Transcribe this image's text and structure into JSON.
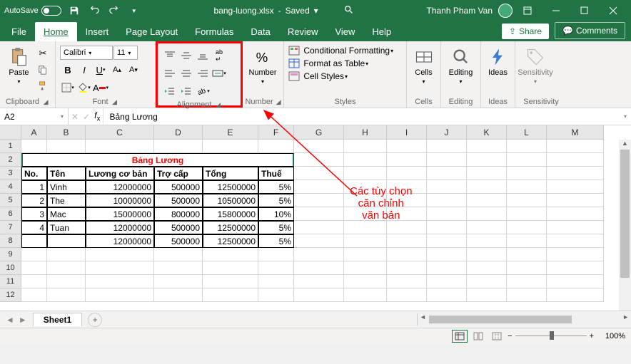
{
  "titlebar": {
    "autosave": "AutoSave",
    "filename": "bang-luong.xlsx",
    "status": "Saved",
    "username": "Thanh Pham Van"
  },
  "tabs": {
    "file": "File",
    "home": "Home",
    "insert": "Insert",
    "pagelayout": "Page Layout",
    "formulas": "Formulas",
    "data": "Data",
    "review": "Review",
    "view": "View",
    "help": "Help",
    "share": "Share",
    "comments": "Comments"
  },
  "ribbon": {
    "clipboard": {
      "label": "Clipboard",
      "paste": "Paste"
    },
    "font": {
      "label": "Font",
      "name": "Calibri",
      "size": "11"
    },
    "alignment": {
      "label": "Alignment"
    },
    "number": {
      "label": "Number",
      "btn": "Number"
    },
    "styles": {
      "label": "Styles",
      "cond": "Conditional Formatting",
      "table": "Format as Table",
      "cell": "Cell Styles"
    },
    "cells": {
      "label": "Cells",
      "btn": "Cells"
    },
    "editing": {
      "label": "Editing",
      "btn": "Editing"
    },
    "ideas": {
      "label": "Ideas",
      "btn": "Ideas"
    },
    "sensitivity": {
      "label": "Sensitivity",
      "btn": "Sensitivity"
    }
  },
  "formula": {
    "namebox": "A2",
    "value": "Bảng Lương"
  },
  "cols": [
    "A",
    "B",
    "C",
    "D",
    "E",
    "F",
    "G",
    "H",
    "I",
    "J",
    "K",
    "L",
    "M"
  ],
  "sheet": {
    "title": "Bảng Lương",
    "headers": {
      "no": "No.",
      "ten": "Tên",
      "luong": "Lương cơ bản",
      "trocap": "Trợ cấp",
      "tong": "Tổng",
      "thue": "Thuế"
    },
    "rows": [
      {
        "no": "1",
        "ten": "Vinh",
        "luong": "12000000",
        "trocap": "500000",
        "tong": "12500000",
        "thue": "5%"
      },
      {
        "no": "2",
        "ten": "The",
        "luong": "10000000",
        "trocap": "500000",
        "tong": "10500000",
        "thue": "5%"
      },
      {
        "no": "3",
        "ten": "Mac",
        "luong": "15000000",
        "trocap": "800000",
        "tong": "15800000",
        "thue": "10%"
      },
      {
        "no": "4",
        "ten": "Tuan",
        "luong": "12000000",
        "trocap": "500000",
        "tong": "12500000",
        "thue": "5%"
      },
      {
        "no": "",
        "ten": "",
        "luong": "12000000",
        "trocap": "500000",
        "tong": "12500000",
        "thue": "5%"
      }
    ]
  },
  "sheettab": "Sheet1",
  "zoom": "100%",
  "annotation": {
    "line1": "Các tùy chọn",
    "line2": "căn chỉnh",
    "line3": "văn bản"
  }
}
